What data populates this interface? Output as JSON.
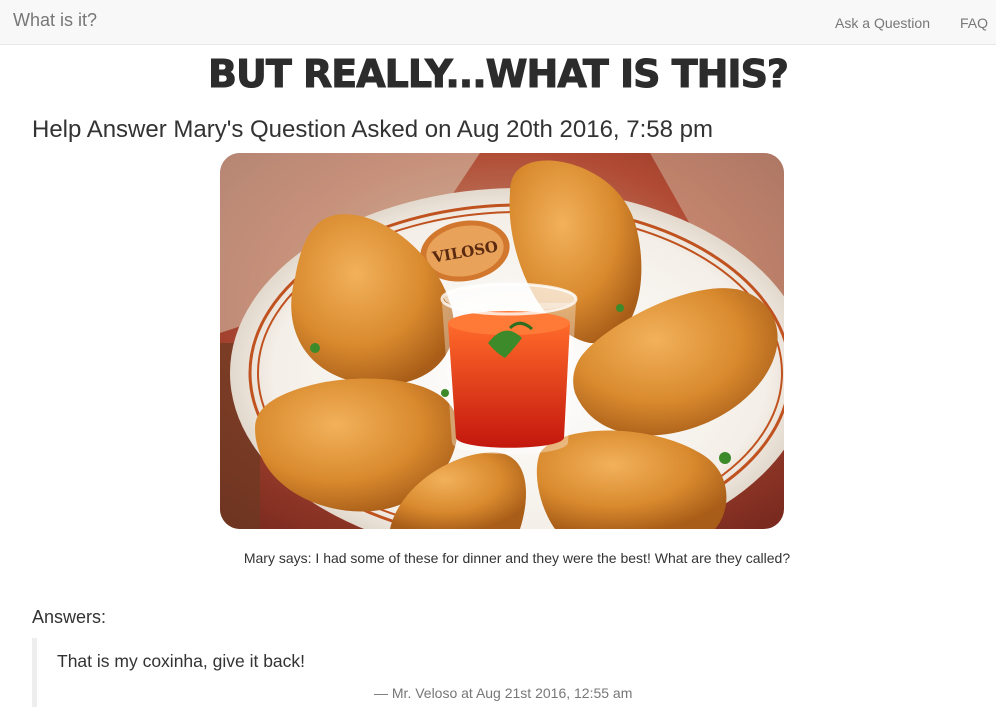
{
  "nav": {
    "brand": "What is it?",
    "links": [
      {
        "label": "Ask a Question"
      },
      {
        "label": "FAQ"
      }
    ]
  },
  "headline": "But Really...What is this?",
  "question": {
    "title": "Help Answer Mary's Question Asked on Aug 20th 2016, 7:58 pm",
    "caption": "Mary says: I had some of these for dinner and they were the best! What are they called?",
    "photo_label": "VILOSO"
  },
  "answers": {
    "heading": "Answers:",
    "items": [
      {
        "text": "That is my coxinha, give it back!",
        "footer": "— Mr. Veloso at Aug 21st 2016, 12:55 am"
      }
    ]
  },
  "colors": {
    "navbar_bg": "#f8f8f8",
    "nav_text": "#777777",
    "headline": "#2c2c2c",
    "answer_border": "#eeeeee"
  }
}
